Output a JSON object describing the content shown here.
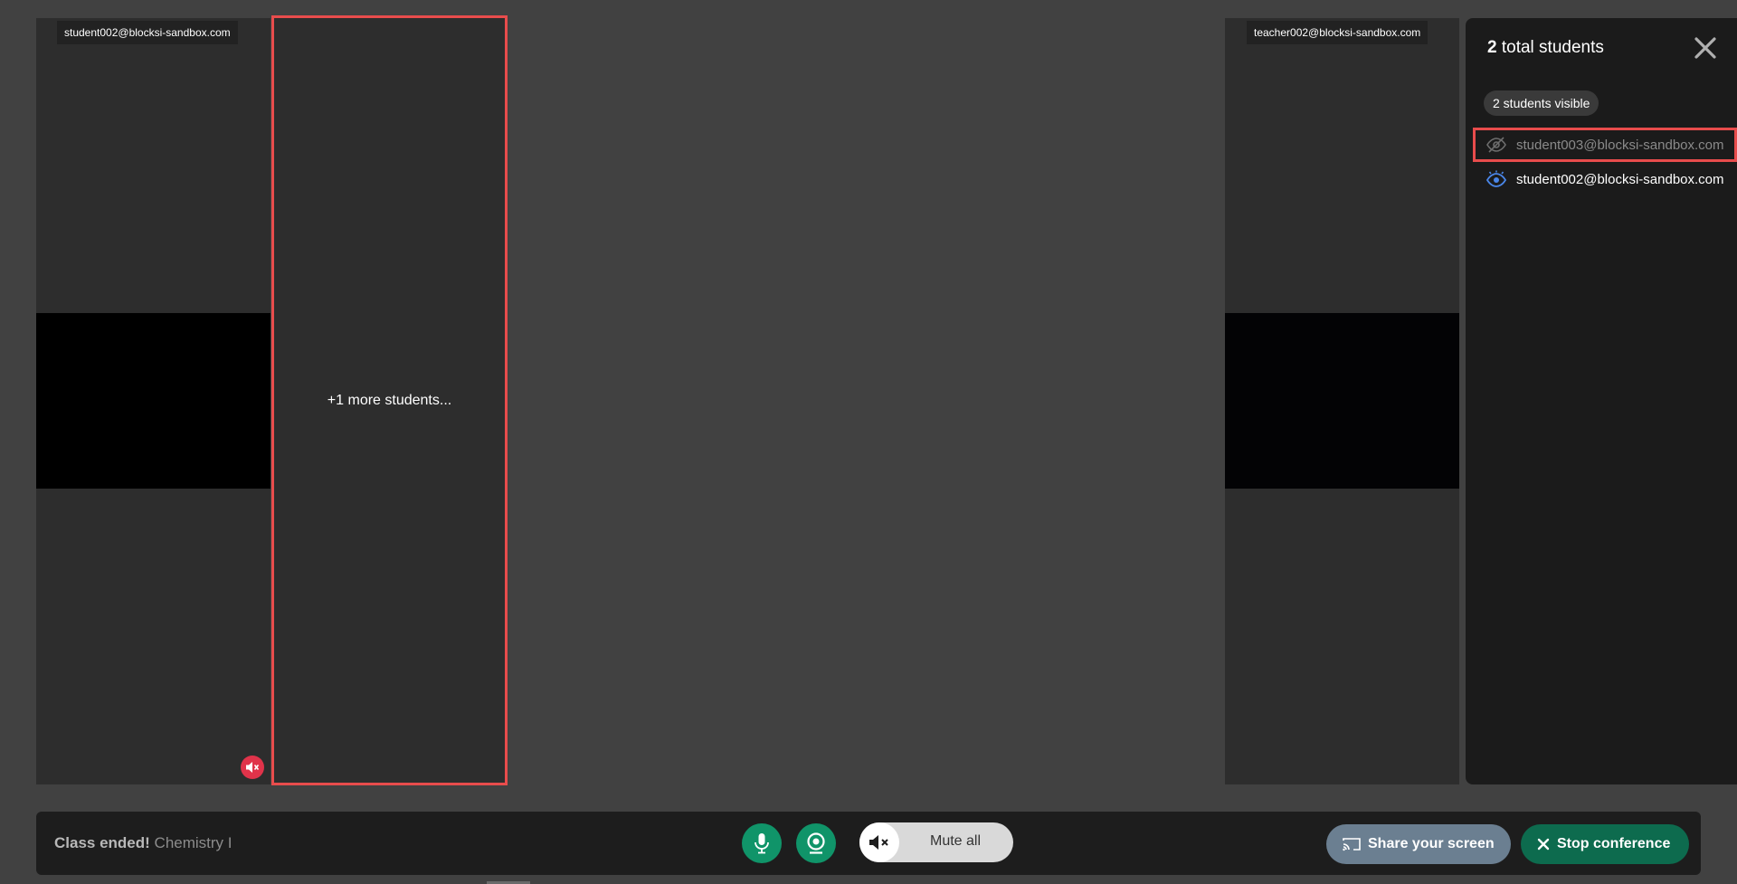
{
  "tiles": {
    "student002": {
      "name": "student002@blocksi-sandbox.com",
      "mic_status": "muted"
    },
    "more": {
      "text": "+1 more students..."
    },
    "teacher": {
      "name": "teacher002@blocksi-sandbox.com"
    }
  },
  "panel": {
    "total_count": "2",
    "total_label": "total students",
    "visible_chip": "2 students visible",
    "students": [
      {
        "email": "student003@blocksi-sandbox.com",
        "visibility": "hidden",
        "icon": "eye-off-icon"
      },
      {
        "email": "student002@blocksi-sandbox.com",
        "visibility": "visible",
        "icon": "eye-icon"
      }
    ]
  },
  "controls": {
    "status_ended": "Class ended!",
    "class_name": "Chemistry I",
    "mute_all_label": "Mute all",
    "share_screen_label": "Share your screen",
    "stop_conference_label": "Stop conference"
  },
  "colors": {
    "accent_green": "#109469",
    "stop_green": "#0d6b4e",
    "share_gray_blue": "#6b7f91",
    "muted_red": "#e0334a",
    "visible_eye_blue": "#4a86e8",
    "highlight_red": "#e84c4c"
  }
}
